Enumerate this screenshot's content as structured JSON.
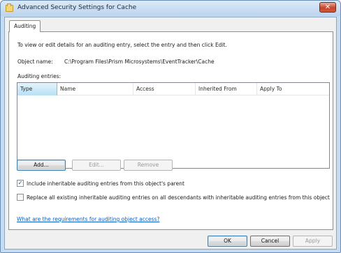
{
  "window": {
    "title": "Advanced Security Settings for Cache",
    "close_glyph": "✕"
  },
  "tabs": [
    {
      "label": "Auditing",
      "selected": true
    }
  ],
  "auditing": {
    "instructions": "To view or edit details for an auditing entry, select the entry and then click Edit.",
    "object_name_label": "Object name:",
    "object_name_value": "C:\\Program Files\\Prism Microsystems\\EventTracker\\Cache",
    "entries_label": "Auditing entries:",
    "columns": [
      "Type",
      "Name",
      "Access",
      "Inherited From",
      "Apply To"
    ],
    "selected_column": "Type",
    "buttons": {
      "add": "Add...",
      "edit": "Edit...",
      "remove": "Remove"
    },
    "include_inheritable": {
      "label": "Include inheritable auditing entries from this object's parent",
      "checked": true
    },
    "replace_all": {
      "label": "Replace all existing inheritable auditing entries on all descendants with inheritable auditing entries from this object",
      "checked": false
    },
    "help_link": "What are the requirements for auditing object access?"
  },
  "footer": {
    "ok": "OK",
    "cancel": "Cancel",
    "apply": "Apply"
  },
  "colors": {
    "title_bar": "#c6dcf2",
    "link": "#0a5fc9",
    "close": "#c8442a"
  }
}
